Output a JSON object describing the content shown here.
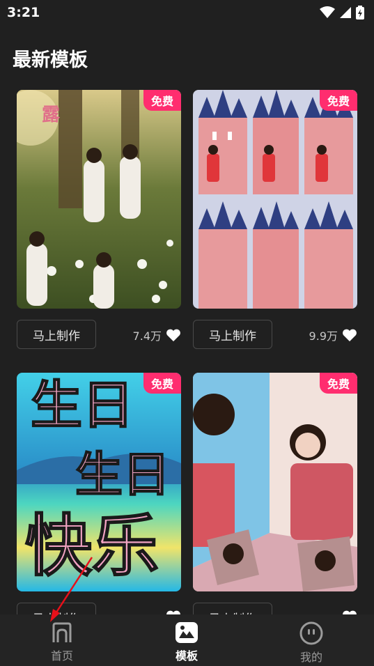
{
  "status": {
    "time": "3:21"
  },
  "page": {
    "title": "最新模板"
  },
  "templates": [
    {
      "badge": "免费",
      "button_label": "马上制作",
      "likes": "7.4万"
    },
    {
      "badge": "免费",
      "button_label": "马上制作",
      "likes": "9.9万"
    },
    {
      "badge": "免费",
      "button_label": "马上制作",
      "likes": ""
    },
    {
      "badge": "免费",
      "button_label": "马上制作",
      "likes": ""
    }
  ],
  "thumb_text": {
    "t1_char": "露",
    "t3_line1": "生日",
    "t3_line2": "生日",
    "t3_line3": "快乐"
  },
  "nav": {
    "items": [
      {
        "label": "首页",
        "icon": "home-icon",
        "active": false
      },
      {
        "label": "模板",
        "icon": "template-icon",
        "active": true
      },
      {
        "label": "我的",
        "icon": "profile-icon",
        "active": false
      }
    ]
  },
  "colors": {
    "background": "#202020",
    "badge": "#ff2d6f",
    "annotation_arrow": "#e8101a"
  }
}
